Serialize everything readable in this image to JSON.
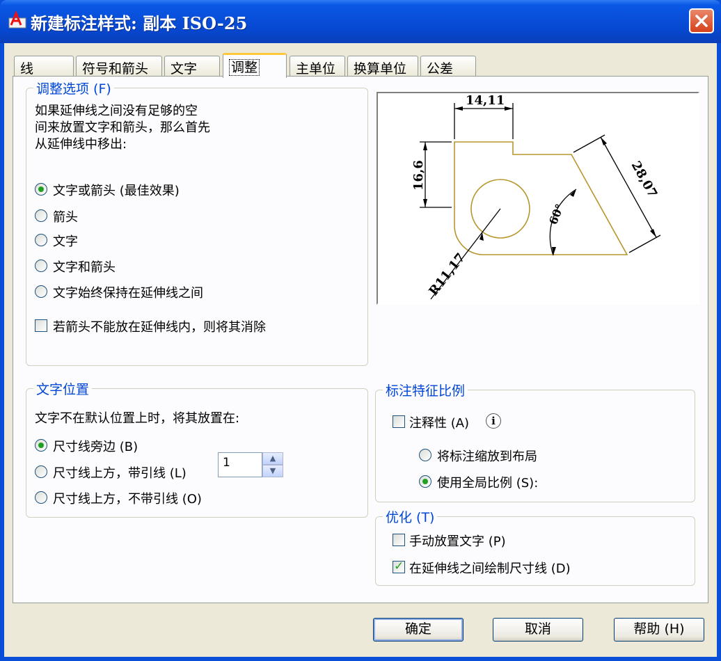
{
  "window": {
    "title": "新建标注样式: 副本 ISO-25"
  },
  "tabs": [
    "线",
    "符号和箭头",
    "文字",
    "调整",
    "主单位",
    "换算单位",
    "公差"
  ],
  "fit_options": {
    "title": "调整选项 (F)",
    "description": [
      "如果延伸线之间没有足够的空",
      "间来放置文字和箭头，那么首先",
      "从延伸线中移出:"
    ],
    "options": [
      "文字或箭头 (最佳效果)",
      "箭头",
      "文字",
      "文字和箭头",
      "文字始终保持在延伸线之间"
    ],
    "selected": 0,
    "suppress_label": "若箭头不能放在延伸线内，则将其消除"
  },
  "text_placement": {
    "title": "文字位置",
    "description": "文字不在默认位置上时，将其放置在:",
    "options": [
      "尺寸线旁边 (B)",
      "尺寸线上方，带引线 (L)",
      "尺寸线上方，不带引线 (O)"
    ],
    "selected": 0
  },
  "scale": {
    "title": "标注特征比例",
    "annotative_label": "注释性 (A)",
    "info_glyph": "i",
    "layout_label": "将标注缩放到布局",
    "global_label": "使用全局比例 (S):",
    "global_value": "1"
  },
  "fine_tuning": {
    "title": "优化 (T)",
    "manual_label": "手动放置文字 (P)",
    "manual_checked": false,
    "draw_label": "在延伸线之间绘制尺寸线 (D)",
    "draw_checked": true
  },
  "preview": {
    "dim_top": "14,11",
    "dim_left": "16,6",
    "dim_right": "28,07",
    "angle": "60°",
    "radius": "R11,17"
  },
  "buttons": {
    "ok": "确定",
    "cancel": "取消",
    "help": "帮助 (H)"
  },
  "colors": {
    "title_bar": "#0747cf",
    "group_title": "#0046d5",
    "radio_dot": "#21a121",
    "preview_outline": "#b8962e"
  }
}
